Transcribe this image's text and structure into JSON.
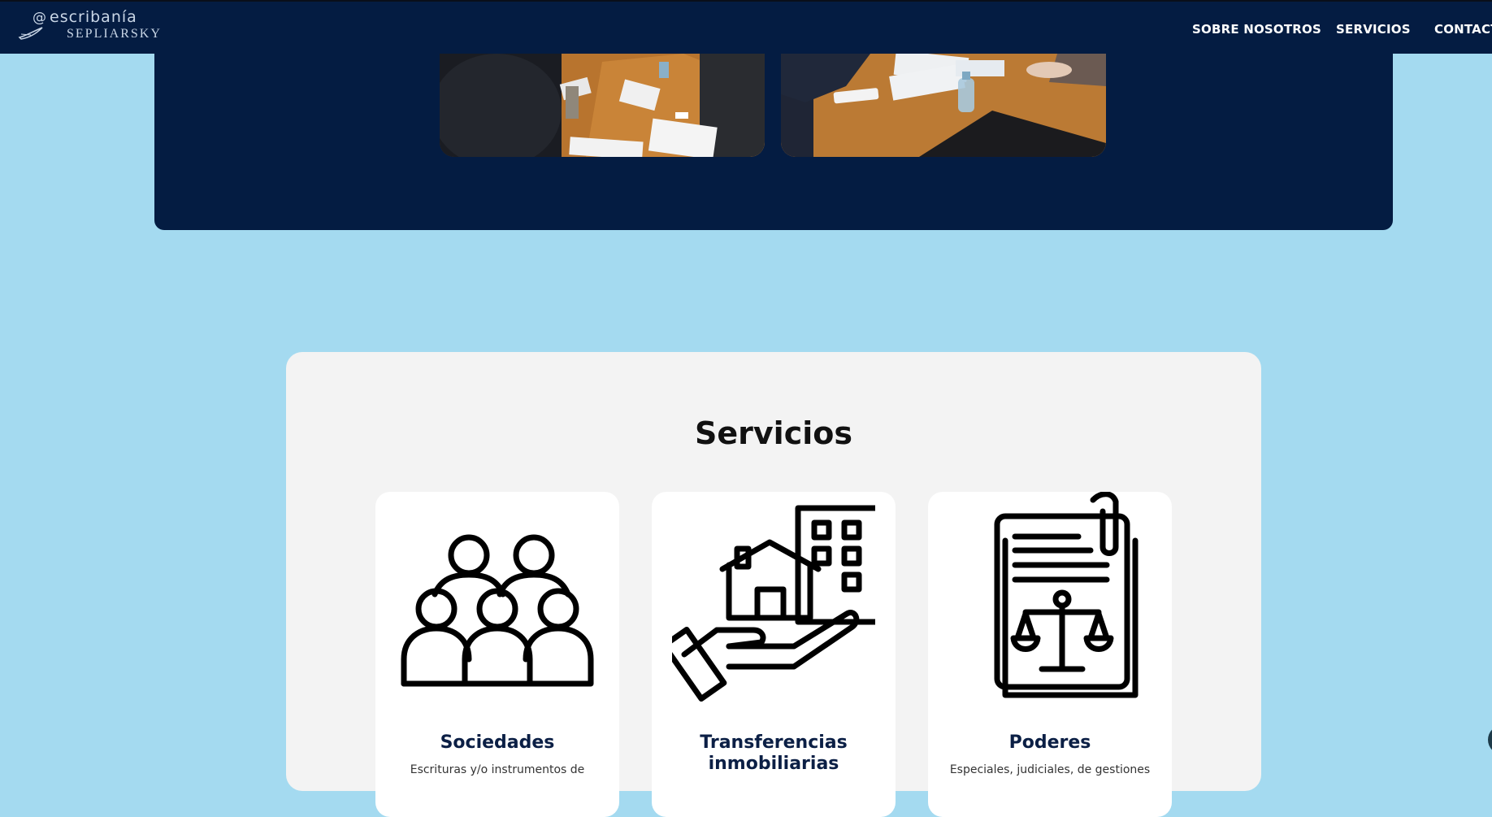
{
  "header": {
    "logo": {
      "at_symbol": "@",
      "line1": "escribanía",
      "line2": "SEPLIARSKY"
    },
    "nav": [
      {
        "label": "SOBRE NOSOTROS"
      },
      {
        "label": "SERVICIOS"
      },
      {
        "label": "CONTACTO"
      }
    ]
  },
  "services": {
    "title": "Servicios",
    "items": [
      {
        "title": "Sociedades",
        "description": "Escrituras y/o instrumentos de",
        "icon": "group-people-icon"
      },
      {
        "title": "Transferencias inmobiliarias",
        "description": "",
        "icon": "house-in-hand-icon"
      },
      {
        "title": "Poderes",
        "description": "Especiales, judiciales, de gestiones",
        "icon": "legal-document-icon"
      }
    ]
  },
  "colors": {
    "navy": "#041c42",
    "page_background": "#a4daf0",
    "card_background": "#f3f3f3"
  }
}
